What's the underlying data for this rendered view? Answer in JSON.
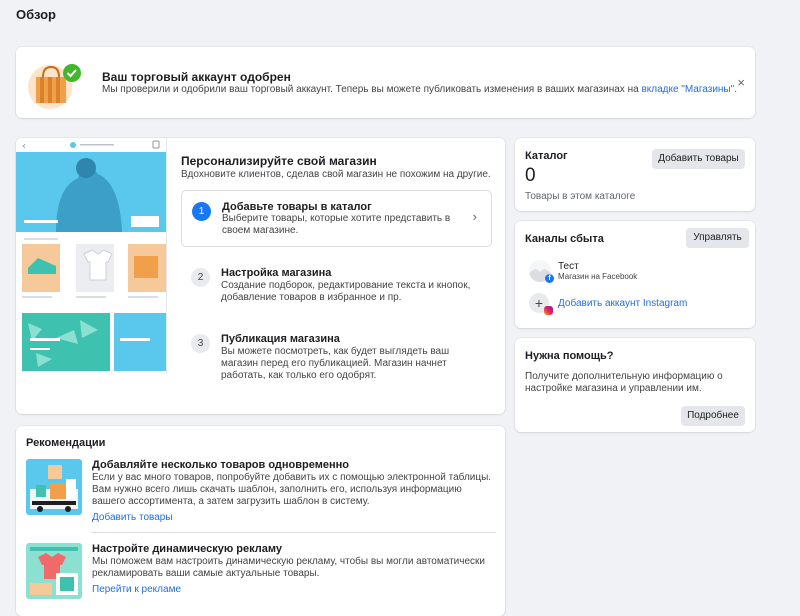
{
  "page": {
    "title": "Обзор"
  },
  "banner": {
    "title": "Ваш торговый аккаунт одобрен",
    "text": "Мы проверили и одобрили ваш торговый аккаунт. Теперь вы можете публиковать изменения в ваших магазинах на ",
    "link": "вкладке \"Магазины\"",
    "end": ".",
    "close": "×"
  },
  "personalize": {
    "title": "Персонализируйте свой магазин",
    "subtitle": "Вдохновите клиентов, сделав свой магазин не похожим на другие.",
    "steps": [
      {
        "num": "1",
        "title": "Добавьте товары в каталог",
        "text": "Выберите товары, которые хотите представить в своем магазине."
      },
      {
        "num": "2",
        "title": "Настройка магазина",
        "text": "Создание подборок, редактирование текста и кнопок, добавление товаров в избранное и пр."
      },
      {
        "num": "3",
        "title": "Публикация магазина",
        "text": "Вы можете посмотреть, как будет выглядеть ваш магазин перед его публикацией. Магазин начнет работать, как только его одобрят."
      }
    ]
  },
  "recommendations": {
    "title": "Рекомендации",
    "items": [
      {
        "title": "Добавляйте несколько товаров одновременно",
        "text": "Если у вас много товаров, попробуйте добавить их с помощью электронной таблицы. Вам нужно всего лишь скачать шаблон, заполнить его, используя информацию вашего ассортимента, а затем загрузить шаблон в систему.",
        "link": "Добавить товары"
      },
      {
        "title": "Настройте динамическую рекламу",
        "text": "Мы поможем вам настроить динамическую рекламу, чтобы вы могли автоматически рекламировать ваши самые актуальные товары.",
        "link": "Перейти к рекламе"
      }
    ]
  },
  "catalog": {
    "title": "Каталог",
    "count": "0",
    "subtitle": "Товары в этом каталоге",
    "button": "Добавить товары"
  },
  "channels": {
    "title": "Каналы сбыта",
    "button": "Управлять",
    "shop_name": "Тест",
    "shop_sub": "Магазин на Facebook",
    "add_instagram": "Добавить аккаунт Instagram"
  },
  "help": {
    "title": "Нужна помощь?",
    "text": "Получите дополнительную информацию о настройке магазина и управлении им.",
    "button": "Подробнее"
  },
  "colors": {
    "background": "#f0f2f5",
    "accent": "#1877f2",
    "link": "#216fdb",
    "success": "#42b72a",
    "illustration_blue": "#5ac8ed"
  }
}
